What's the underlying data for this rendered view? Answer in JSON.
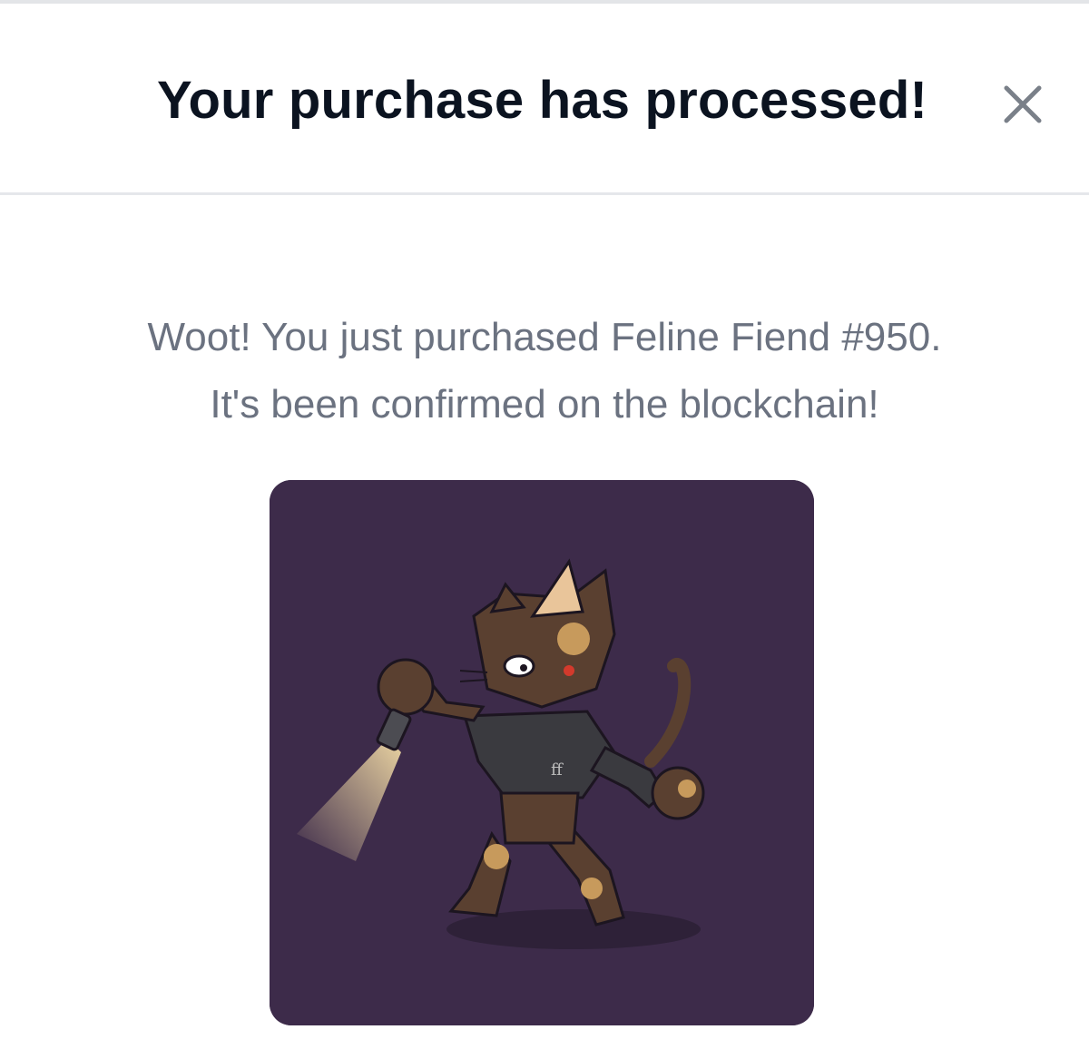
{
  "modal": {
    "title": "Your purchase has processed!",
    "close_icon": "close-icon"
  },
  "message": {
    "line1": "Woot! You just purchased Feline Fiend #950.",
    "line2": "It's been confirmed on the blockchain!"
  },
  "nft": {
    "name": "Feline Fiend #950",
    "background_color": "#3d2b4a",
    "hoodie_text": "ff"
  },
  "colors": {
    "title": "#0b1320",
    "body_text": "#6b7280",
    "close_icon": "#7a8089",
    "divider": "#e5e7eb"
  }
}
